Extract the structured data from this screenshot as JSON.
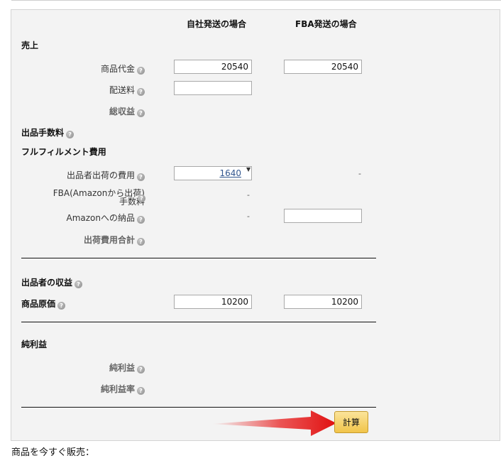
{
  "headers": {
    "own": "自社発送の場合",
    "fba": "FBA発送の場合"
  },
  "sections": {
    "sales": "売上",
    "selling_fee": "出品手数料",
    "fulfillment": "フルフィルメント費用",
    "seller_profit": "出品者の収益",
    "cost": "商品原価",
    "net_profit": "純利益"
  },
  "labels": {
    "item_price": "商品代金",
    "shipping": "配送料",
    "total_revenue": "総収益",
    "seller_shipping_cost": "出品者出荷の費用",
    "fba_fee_line1": "FBA(Amazonから出荷)",
    "fba_fee_line2": "手数料",
    "amazon_inbound": "Amazonへの納品",
    "total_shipping": "出荷費用合計",
    "net_profit": "純利益",
    "net_margin": "純利益率"
  },
  "help_icon": "question-icon",
  "values": {
    "own_item_price": "20540",
    "fba_item_price": "20540",
    "own_shipping": "",
    "own_seller_shipping": "1640",
    "fba_seller_shipping": "-",
    "own_fba_fee": "-",
    "own_amazon_inbound": "-",
    "fba_amazon_inbound": "",
    "own_cost": "10200",
    "fba_cost": "10200"
  },
  "buttons": {
    "calculate": "計算"
  },
  "footer_text": "商品を今すぐ販売："
}
